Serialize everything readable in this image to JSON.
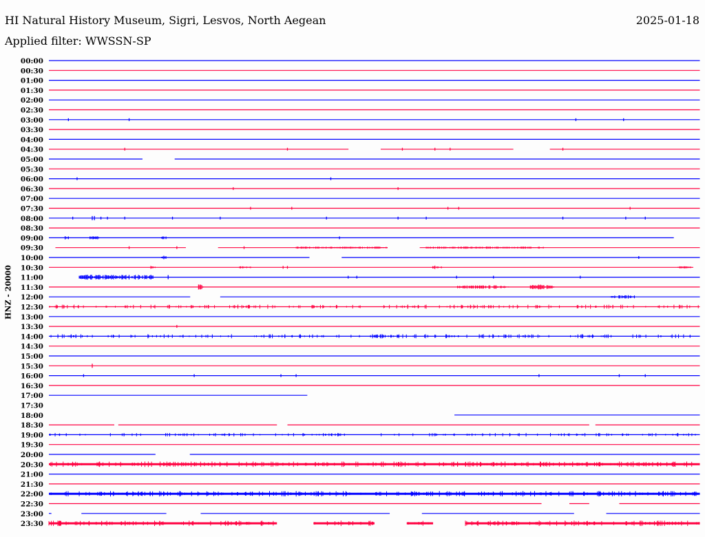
{
  "header": {
    "station": "HI Natural History Museum, Sigri, Lesvos, North Aegean",
    "filter": "Applied filter: WWSSN-SP",
    "date": "2025-01-18"
  },
  "chart_data": {
    "type": "line",
    "title": "HI Natural History Museum, Sigri, Lesvos, North Aegean",
    "ylabel": "HNZ - 20000",
    "xlabel": "",
    "row_minutes": 30,
    "colors": [
      "#0000ff",
      "#ff0040"
    ],
    "rows": [
      {
        "label": "00:00"
      },
      {
        "label": "00:30"
      },
      {
        "label": "01:00"
      },
      {
        "label": "01:30"
      },
      {
        "label": "02:00"
      },
      {
        "label": "02:30"
      },
      {
        "label": "03:00",
        "events": [
          [
            0.9,
            1
          ],
          [
            3.7,
            1
          ],
          [
            24.3,
            1
          ],
          [
            26.5,
            1
          ]
        ]
      },
      {
        "label": "03:30"
      },
      {
        "label": "04:00"
      },
      {
        "label": "04:30",
        "segments": [
          [
            0,
            13.8
          ],
          [
            15.3,
            21.4
          ],
          [
            23.1,
            30
          ]
        ],
        "events": [
          [
            3.5,
            1
          ],
          [
            11,
            1
          ],
          [
            16.3,
            1
          ],
          [
            17.8,
            1
          ],
          [
            18.5,
            1
          ],
          [
            23.7,
            1
          ]
        ]
      },
      {
        "label": "05:00",
        "segments": [
          [
            0,
            4.3
          ],
          [
            5.8,
            30
          ]
        ]
      },
      {
        "label": "05:30"
      },
      {
        "label": "06:00",
        "events": [
          [
            1.3,
            1
          ],
          [
            13,
            1
          ]
        ]
      },
      {
        "label": "06:30",
        "events": [
          [
            8.5,
            1
          ],
          [
            16.1,
            1
          ]
        ]
      },
      {
        "label": "07:00"
      },
      {
        "label": "07:30",
        "events": [
          [
            9.3,
            1
          ],
          [
            11.2,
            1
          ],
          [
            18.4,
            1
          ],
          [
            18.9,
            1
          ],
          [
            26.8,
            1
          ]
        ]
      },
      {
        "label": "08:00",
        "events": [
          [
            1.1,
            1
          ],
          [
            2,
            2
          ],
          [
            2.1,
            2
          ],
          [
            2.4,
            1
          ],
          [
            2.7,
            1
          ],
          [
            3.5,
            1
          ],
          [
            5.7,
            1
          ],
          [
            7.9,
            1
          ],
          [
            12.8,
            1
          ],
          [
            16.1,
            1
          ],
          [
            17.4,
            1
          ],
          [
            23.7,
            1
          ],
          [
            26.6,
            1
          ],
          [
            27.5,
            1
          ]
        ]
      },
      {
        "label": "08:30"
      },
      {
        "label": "09:00",
        "segments": [
          [
            0,
            28.8
          ]
        ],
        "bursts": [
          [
            0.7,
            0.9,
            2
          ],
          [
            1.9,
            2.3,
            2
          ],
          [
            5.2,
            5.4,
            2
          ]
        ],
        "events": [
          [
            1.9,
            1
          ],
          [
            13.4,
            1
          ]
        ]
      },
      {
        "label": "09:30",
        "segments": [
          [
            0.3,
            6.3
          ],
          [
            7.8,
            15.6
          ],
          [
            17.1,
            30
          ]
        ],
        "bursts": [
          [
            11.4,
            15.6,
            1
          ],
          [
            17.4,
            22.8,
            1
          ]
        ],
        "events": [
          [
            3.7,
            1
          ],
          [
            5.9,
            1
          ],
          [
            9,
            1
          ]
        ]
      },
      {
        "label": "10:00",
        "segments": [
          [
            0,
            12
          ],
          [
            13.5,
            30
          ]
        ],
        "bursts": [
          [
            5.2,
            5.4,
            2
          ]
        ],
        "events": [
          [
            27.2,
            1
          ]
        ]
      },
      {
        "label": "10:30",
        "segments": [
          [
            0,
            29.7
          ]
        ],
        "bursts": [
          [
            4.7,
            4.9,
            2
          ],
          [
            8.8,
            9.3,
            1
          ],
          [
            17.7,
            18.1,
            2
          ],
          [
            29,
            29.6,
            1
          ]
        ],
        "events": [
          [
            10.8,
            1
          ],
          [
            11,
            1
          ]
        ]
      },
      {
        "label": "11:00",
        "segments": [
          [
            1.4,
            30
          ]
        ],
        "bursts": [
          [
            1.4,
            4.8,
            3
          ]
        ],
        "events": [
          [
            5.5,
            2
          ],
          [
            13.8,
            1
          ],
          [
            14.2,
            1
          ],
          [
            18.8,
            1
          ],
          [
            20.5,
            1
          ],
          [
            24.5,
            1
          ]
        ]
      },
      {
        "label": "11:30",
        "bursts": [
          [
            6.9,
            7.1,
            4
          ],
          [
            18.8,
            21.2,
            2
          ],
          [
            22.2,
            23.3,
            3
          ]
        ]
      },
      {
        "label": "12:00",
        "segments": [
          [
            0,
            6.5
          ],
          [
            7.9,
            30
          ]
        ],
        "bursts": [
          [
            25.9,
            27,
            2
          ]
        ]
      },
      {
        "label": "12:30",
        "noise": 2
      },
      {
        "label": "13:00"
      },
      {
        "label": "13:30",
        "events": [
          [
            5.9,
            1
          ]
        ]
      },
      {
        "label": "14:00",
        "noise": 2
      },
      {
        "label": "14:30"
      },
      {
        "label": "15:00"
      },
      {
        "label": "15:30",
        "events": [
          [
            2,
            2
          ]
        ]
      },
      {
        "label": "16:00",
        "events": [
          [
            1.6,
            1
          ],
          [
            6.7,
            1
          ],
          [
            10.7,
            1
          ],
          [
            11.4,
            1
          ],
          [
            22.6,
            1
          ],
          [
            26.3,
            1
          ],
          [
            27.5,
            1
          ]
        ]
      },
      {
        "label": "16:30"
      },
      {
        "label": "17:00",
        "segments": [
          [
            0,
            11.9
          ]
        ]
      },
      {
        "label": "17:30",
        "segments": []
      },
      {
        "label": "18:00",
        "segments": [
          [
            18.7,
            30
          ]
        ]
      },
      {
        "label": "18:30",
        "segments": [
          [
            0,
            3
          ],
          [
            3.2,
            10.5
          ],
          [
            11,
            24.9
          ],
          [
            25.2,
            30
          ]
        ]
      },
      {
        "label": "19:00",
        "noise": 1.5
      },
      {
        "label": "19:30"
      },
      {
        "label": "20:00",
        "segments": [
          [
            0,
            4.9
          ],
          [
            6.5,
            30
          ]
        ]
      },
      {
        "label": "20:30",
        "noise": 3
      },
      {
        "label": "21:00"
      },
      {
        "label": "21:30"
      },
      {
        "label": "22:00",
        "noise": 3
      },
      {
        "label": "22:30",
        "segments": [
          [
            0,
            22.7
          ],
          [
            24,
            24.9
          ],
          [
            26.3,
            30
          ]
        ]
      },
      {
        "label": "23:00",
        "segments": [
          [
            0,
            0.1
          ],
          [
            1.5,
            5.4
          ],
          [
            7,
            15.7
          ],
          [
            17.2,
            24.2
          ],
          [
            25.7,
            30
          ]
        ]
      },
      {
        "label": "23:30",
        "segments": [
          [
            0,
            10.5
          ],
          [
            12.2,
            15
          ],
          [
            16.5,
            17.7
          ],
          [
            19.2,
            30
          ]
        ],
        "noise": 3
      }
    ]
  }
}
